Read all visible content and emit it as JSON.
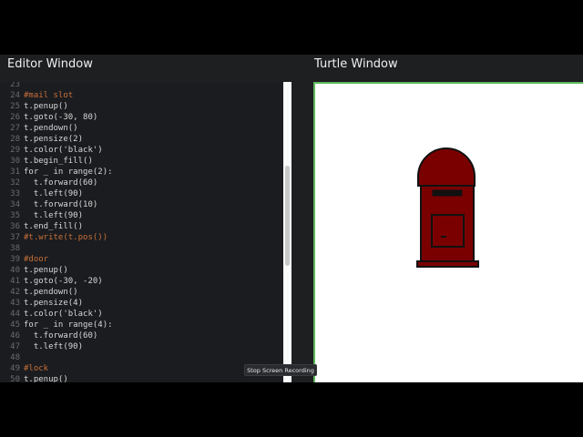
{
  "editor": {
    "title": "Editor Window",
    "lines": [
      {
        "n": "23",
        "text": ""
      },
      {
        "n": "24",
        "text": "#mail slot"
      },
      {
        "n": "25",
        "text": "t.penup()"
      },
      {
        "n": "26",
        "text": "t.goto(-30, 80)"
      },
      {
        "n": "27",
        "text": "t.pendown()"
      },
      {
        "n": "28",
        "text": "t.pensize(2)"
      },
      {
        "n": "29",
        "text": "t.color('black')"
      },
      {
        "n": "30",
        "text": "t.begin_fill()"
      },
      {
        "n": "31",
        "text": "for _ in range(2):"
      },
      {
        "n": "32",
        "text": "  t.forward(60)"
      },
      {
        "n": "33",
        "text": "  t.left(90)"
      },
      {
        "n": "34",
        "text": "  t.forward(10)"
      },
      {
        "n": "35",
        "text": "  t.left(90)"
      },
      {
        "n": "36",
        "text": "t.end_fill()"
      },
      {
        "n": "37",
        "text": "#t.write(t.pos())"
      },
      {
        "n": "38",
        "text": ""
      },
      {
        "n": "39",
        "text": "#door"
      },
      {
        "n": "40",
        "text": "t.penup()"
      },
      {
        "n": "41",
        "text": "t.goto(-30, -20)"
      },
      {
        "n": "42",
        "text": "t.pendown()"
      },
      {
        "n": "43",
        "text": "t.pensize(4)"
      },
      {
        "n": "44",
        "text": "t.color('black')"
      },
      {
        "n": "45",
        "text": "for _ in range(4):"
      },
      {
        "n": "46",
        "text": "  t.forward(60)"
      },
      {
        "n": "47",
        "text": "  t.left(90)"
      },
      {
        "n": "48",
        "text": ""
      },
      {
        "n": "49",
        "text": "#lock"
      },
      {
        "n": "50",
        "text": "t.penup()"
      }
    ]
  },
  "turtle": {
    "title": "Turtle Window",
    "colors": {
      "fill": "#7a0000",
      "outline": "#111111",
      "border": "#5cb85c"
    }
  },
  "overlay": {
    "stop_recording_label": "Stop Screen Recording"
  }
}
